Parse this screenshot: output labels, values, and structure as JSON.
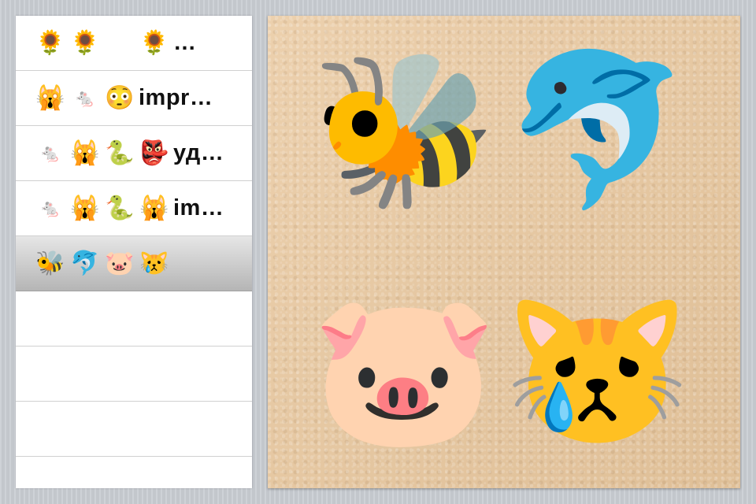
{
  "list": {
    "rows": [
      {
        "emojis": [
          "🌻",
          "🌻",
          "",
          "🌻"
        ],
        "text": "…",
        "selected": false
      },
      {
        "emojis": [
          "🙀",
          "🐁",
          "😳"
        ],
        "text": "impr…",
        "selected": false
      },
      {
        "emojis": [
          "🐁",
          "🙀",
          "🐍",
          "👺"
        ],
        "text": "уд…",
        "selected": false
      },
      {
        "emojis": [
          "🐁",
          "🙀",
          "🐍",
          "🙀"
        ],
        "text": "im…",
        "selected": false
      },
      {
        "emojis": [
          "🐝",
          "🐬",
          "🐷",
          "😿"
        ],
        "text": "",
        "selected": true
      },
      {
        "emojis": [],
        "text": "",
        "selected": false
      },
      {
        "emojis": [],
        "text": "",
        "selected": false
      },
      {
        "emojis": [],
        "text": "",
        "selected": false
      }
    ]
  },
  "board": {
    "tiles": [
      "🐝",
      "🐬",
      "🐷",
      "😿"
    ]
  }
}
